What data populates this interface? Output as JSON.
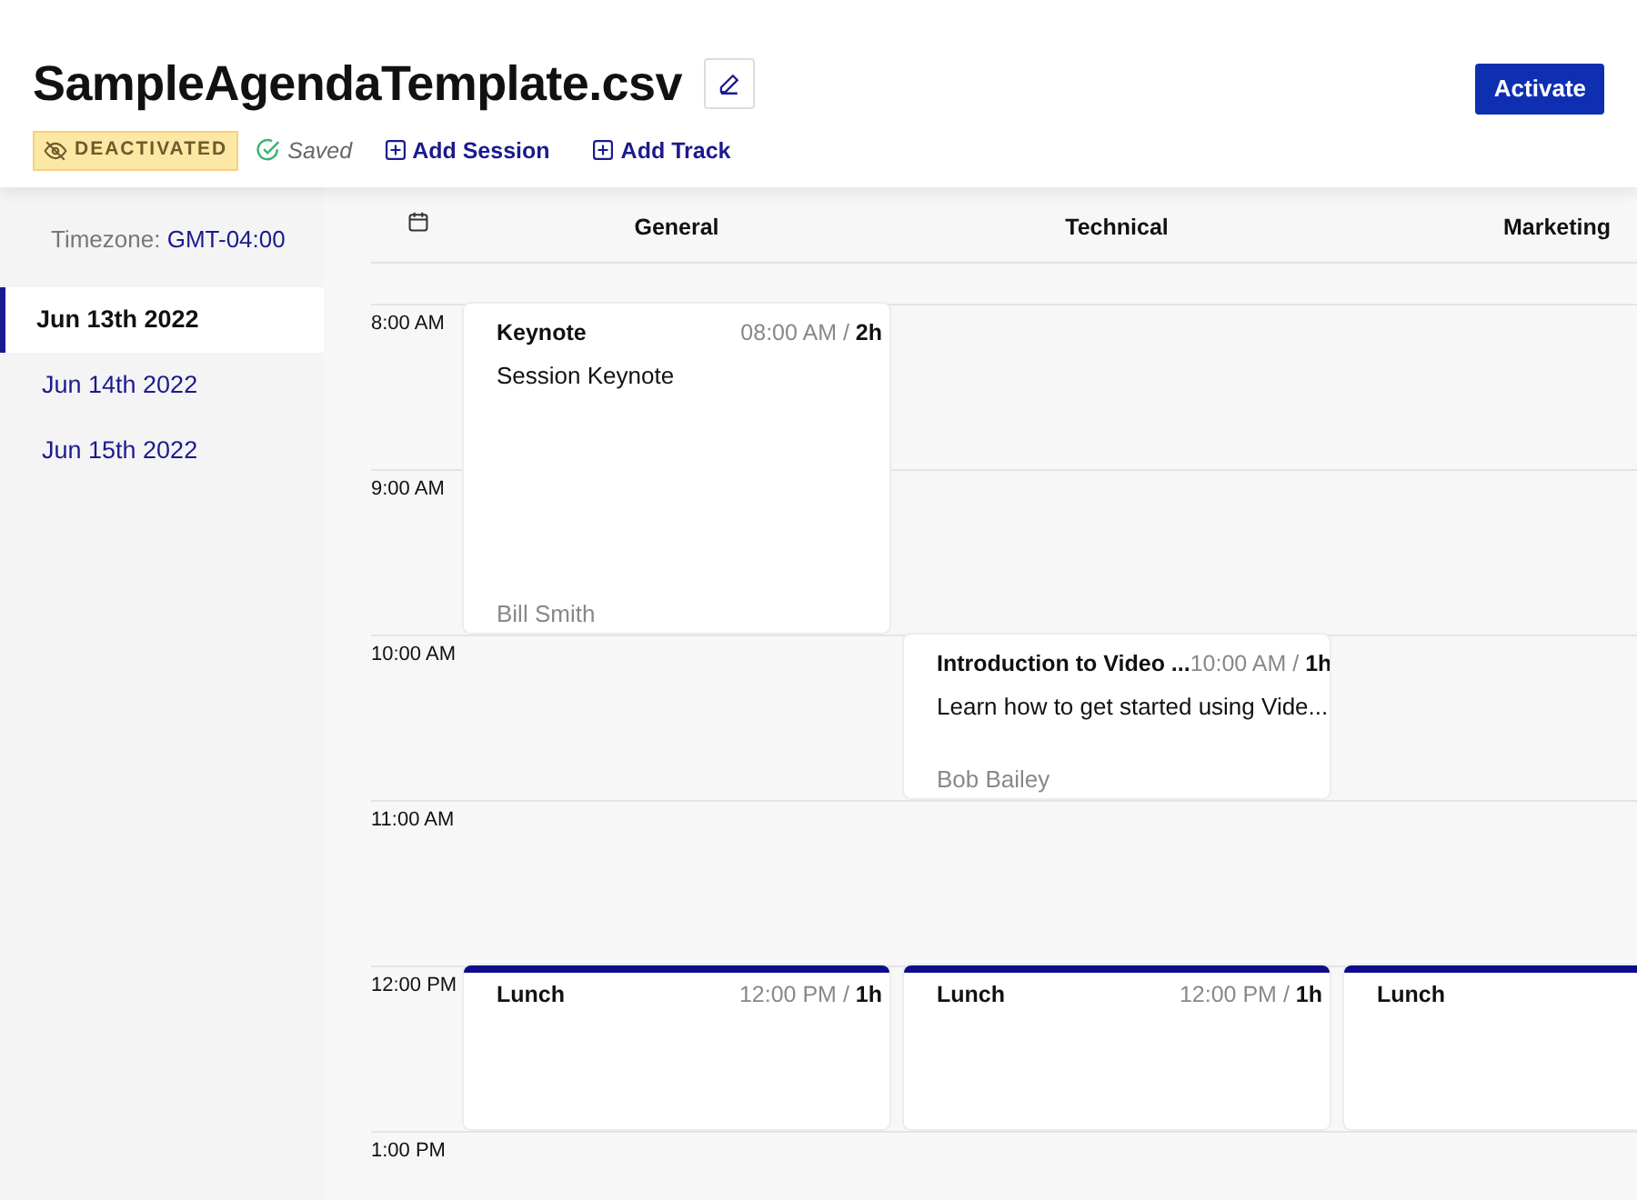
{
  "header": {
    "title": "SampleAgendaTemplate.csv",
    "status_badge": "DEACTIVATED",
    "save_state": "Saved",
    "actions": [
      "Add Session",
      "Add Track"
    ],
    "primary_button": "Activate"
  },
  "sidebar": {
    "timezone_label": "Timezone:",
    "timezone": "GMT-04:00",
    "days": [
      {
        "label": "Jun 13th 2022",
        "selected": true
      },
      {
        "label": "Jun 14th 2022",
        "selected": false
      },
      {
        "label": "Jun 15th 2022",
        "selected": false
      }
    ]
  },
  "tracks": [
    "General",
    "Technical",
    "Marketing"
  ],
  "slots": [
    {
      "label": "8:00 AM",
      "cells": [
        {
          "kind": "session",
          "title": "Keynote",
          "time": "08:00 AM /",
          "duration": "2h",
          "description": "Session Keynote",
          "speaker": "Bill Smith"
        },
        null,
        null
      ]
    },
    {
      "label": "9:00 AM",
      "cells": [
        null,
        null,
        null
      ]
    },
    {
      "label": "10:00 AM",
      "cells": [
        null,
        {
          "kind": "session",
          "title": "Introduction to Video ...",
          "time": "10:00 AM /",
          "duration": "1h",
          "description": "Learn how to get started using Vide...",
          "speaker": "Bob Bailey"
        },
        null
      ]
    },
    {
      "label": "11:00 AM",
      "cells": [
        null,
        null,
        null
      ]
    },
    {
      "label": "12:00 PM",
      "cells": [
        {
          "kind": "break",
          "title": "Lunch",
          "time": "12:00 PM /",
          "duration": "1h"
        },
        {
          "kind": "break",
          "title": "Lunch",
          "time": "12:00 PM /",
          "duration": "1h"
        },
        {
          "kind": "break",
          "title": "Lunch"
        }
      ]
    },
    {
      "label": "1:00 PM",
      "cells": [
        null,
        null,
        null
      ]
    }
  ]
}
